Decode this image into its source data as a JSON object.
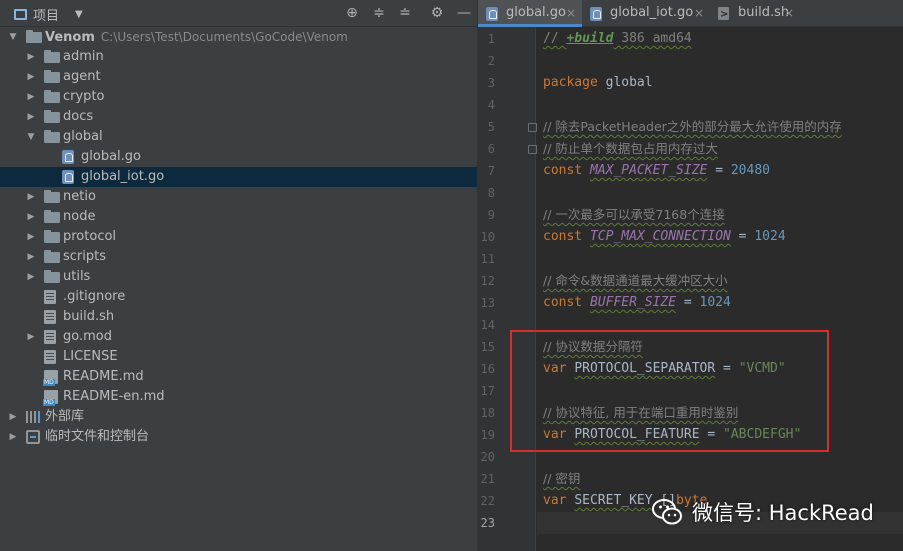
{
  "project_panel": {
    "title": "项目",
    "toolbar_icons": [
      "crosshair-icon",
      "collapse-all-icon",
      "expand-all-icon",
      "gear-icon",
      "hide-icon"
    ],
    "tree": [
      {
        "label": "Venom",
        "sub": "C:\\Users\\Test\\Documents\\GoCode\\Venom",
        "depth": 0,
        "kind": "folder",
        "expanded": true,
        "bold": true
      },
      {
        "label": "admin",
        "depth": 1,
        "kind": "folder",
        "expanded": false
      },
      {
        "label": "agent",
        "depth": 1,
        "kind": "folder",
        "expanded": false
      },
      {
        "label": "crypto",
        "depth": 1,
        "kind": "folder",
        "expanded": false
      },
      {
        "label": "docs",
        "depth": 1,
        "kind": "folder",
        "expanded": false
      },
      {
        "label": "global",
        "depth": 1,
        "kind": "folder",
        "expanded": true
      },
      {
        "label": "global.go",
        "depth": 2,
        "kind": "go"
      },
      {
        "label": "global_iot.go",
        "depth": 2,
        "kind": "go",
        "selected": true
      },
      {
        "label": "netio",
        "depth": 1,
        "kind": "folder",
        "expanded": false
      },
      {
        "label": "node",
        "depth": 1,
        "kind": "folder",
        "expanded": false
      },
      {
        "label": "protocol",
        "depth": 1,
        "kind": "folder",
        "expanded": false
      },
      {
        "label": "scripts",
        "depth": 1,
        "kind": "folder",
        "expanded": false
      },
      {
        "label": "utils",
        "depth": 1,
        "kind": "folder",
        "expanded": false
      },
      {
        "label": ".gitignore",
        "depth": 1,
        "kind": "txt"
      },
      {
        "label": "build.sh",
        "depth": 1,
        "kind": "txt"
      },
      {
        "label": "go.mod",
        "depth": 1,
        "kind": "txt",
        "expandable": true
      },
      {
        "label": "LICENSE",
        "depth": 1,
        "kind": "txt"
      },
      {
        "label": "README.md",
        "depth": 1,
        "kind": "md"
      },
      {
        "label": "README-en.md",
        "depth": 1,
        "kind": "md"
      },
      {
        "label": "外部库",
        "depth": 0,
        "kind": "lib",
        "expandable": true
      },
      {
        "label": "临时文件和控制台",
        "depth": 0,
        "kind": "scratch",
        "expandable": true
      }
    ]
  },
  "editor": {
    "tabs": [
      {
        "label": "global.go",
        "icon": "go-file-icon",
        "active": true,
        "close": "×"
      },
      {
        "label": "global_iot.go",
        "icon": "go-file-icon",
        "active": false,
        "close": "×"
      },
      {
        "label": "build.sh",
        "icon": "shell-file-icon",
        "active": false,
        "close": "×"
      }
    ],
    "current_line": "23",
    "lines": [
      {
        "n": "1",
        "tokens": [
          {
            "t": "// ",
            "c": "comment"
          },
          {
            "t": "+build",
            "c": "build"
          },
          {
            "t": " 386 amd64",
            "c": "comment"
          }
        ]
      },
      {
        "n": "2",
        "tokens": []
      },
      {
        "n": "3",
        "tokens": [
          {
            "t": "package",
            "c": "kw"
          },
          {
            "t": " global",
            "c": "op"
          }
        ]
      },
      {
        "n": "4",
        "tokens": []
      },
      {
        "n": "5",
        "fold": true,
        "tokens": [
          {
            "t": "// 除去PacketHeader之外的部分最大允许使用的内存",
            "c": "comment-cjk"
          }
        ]
      },
      {
        "n": "6",
        "fold": true,
        "tokens": [
          {
            "t": "// 防止单个数据包占用内存过大",
            "c": "comment-cjk"
          }
        ]
      },
      {
        "n": "7",
        "tokens": [
          {
            "t": "const",
            "c": "kw"
          },
          {
            "t": " ",
            "c": "op"
          },
          {
            "t": "MAX_PACKET_SIZE",
            "c": "const"
          },
          {
            "t": " = ",
            "c": "op"
          },
          {
            "t": "20480",
            "c": "num"
          }
        ]
      },
      {
        "n": "8",
        "tokens": []
      },
      {
        "n": "9",
        "tokens": [
          {
            "t": "// 一次最多可以承受7168个连接",
            "c": "comment-cjk"
          }
        ]
      },
      {
        "n": "10",
        "tokens": [
          {
            "t": "const",
            "c": "kw"
          },
          {
            "t": " ",
            "c": "op"
          },
          {
            "t": "TCP_MAX_CONNECTION",
            "c": "const"
          },
          {
            "t": " = ",
            "c": "op"
          },
          {
            "t": "1024",
            "c": "num"
          }
        ]
      },
      {
        "n": "11",
        "tokens": []
      },
      {
        "n": "12",
        "tokens": [
          {
            "t": "// 命令&数据通道最大缓冲区大小",
            "c": "comment-cjk"
          }
        ]
      },
      {
        "n": "13",
        "tokens": [
          {
            "t": "const",
            "c": "kw"
          },
          {
            "t": " ",
            "c": "op"
          },
          {
            "t": "BUFFER_SIZE",
            "c": "const"
          },
          {
            "t": " = ",
            "c": "op"
          },
          {
            "t": "1024",
            "c": "num"
          }
        ]
      },
      {
        "n": "14",
        "tokens": []
      },
      {
        "n": "15",
        "tokens": [
          {
            "t": "// 协议数据分隔符",
            "c": "comment-cjk"
          }
        ]
      },
      {
        "n": "16",
        "tokens": [
          {
            "t": "var",
            "c": "kw"
          },
          {
            "t": " ",
            "c": "op"
          },
          {
            "t": "PROTOCOL_SEPARATOR",
            "c": "var"
          },
          {
            "t": " = ",
            "c": "op"
          },
          {
            "t": "\"VCMD\"",
            "c": "str"
          }
        ]
      },
      {
        "n": "17",
        "tokens": []
      },
      {
        "n": "18",
        "tokens": [
          {
            "t": "// 协议特征, 用于在端口重用时鉴别",
            "c": "comment-cjk"
          }
        ]
      },
      {
        "n": "19",
        "tokens": [
          {
            "t": "var",
            "c": "kw"
          },
          {
            "t": " ",
            "c": "op"
          },
          {
            "t": "PROTOCOL_FEATURE",
            "c": "var"
          },
          {
            "t": " = ",
            "c": "op"
          },
          {
            "t": "\"ABCDEFGH\"",
            "c": "str"
          }
        ]
      },
      {
        "n": "20",
        "tokens": []
      },
      {
        "n": "21",
        "tokens": [
          {
            "t": "// 密钥",
            "c": "comment-cjk"
          }
        ]
      },
      {
        "n": "22",
        "tokens": [
          {
            "t": "var",
            "c": "kw"
          },
          {
            "t": " ",
            "c": "op"
          },
          {
            "t": "SECRET_KEY",
            "c": "var"
          },
          {
            "t": " []",
            "c": "op"
          },
          {
            "t": "byte",
            "c": "type"
          }
        ]
      },
      {
        "n": "23",
        "tokens": []
      }
    ]
  },
  "watermark": {
    "text": "微信号: HackRead"
  },
  "colors": {
    "highlight_box": "#d62d2d",
    "selection": "#0d293e",
    "tab_accent": "#4a88c7"
  }
}
